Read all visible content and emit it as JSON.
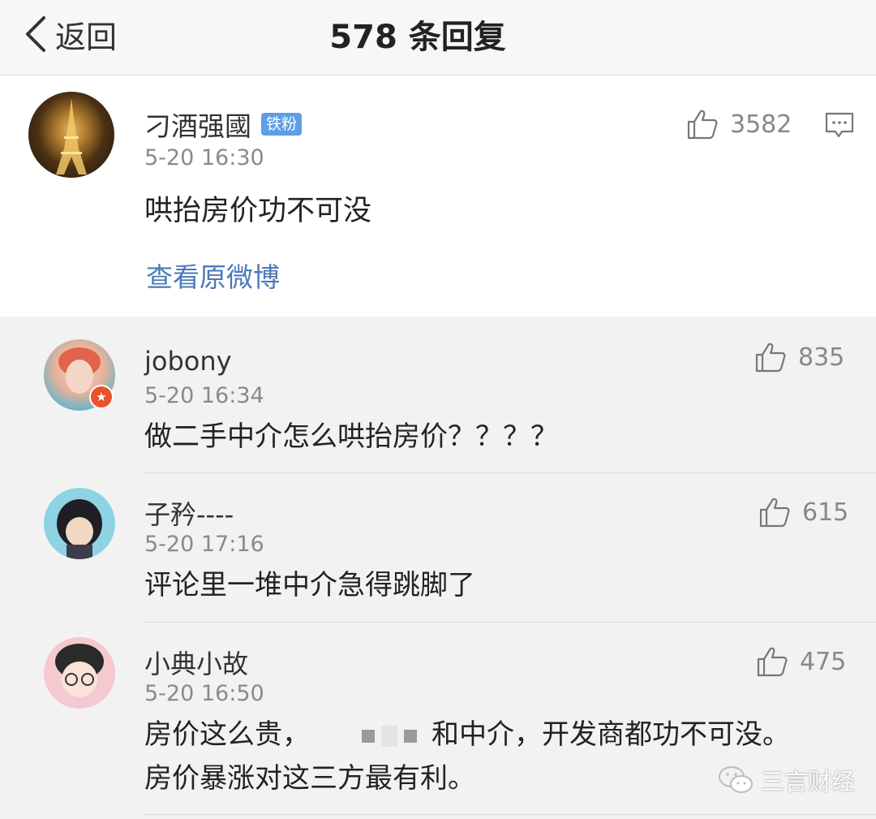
{
  "header": {
    "back_label": "返回",
    "title": "578 条回复"
  },
  "main_comment": {
    "name": "刁酒强國",
    "badge": "铁粉",
    "time": "5-20 16:30",
    "text": "哄抬房价功不可没",
    "likes": "3582",
    "view_original": "查看原微博"
  },
  "replies": [
    {
      "name": "jobony",
      "time": "5-20 16:34",
      "text": "做二手中介怎么哄抬房价？？？？",
      "likes": "835"
    },
    {
      "name": "子矜----",
      "time": "5-20 17:16",
      "text": "评论里一堆中介急得跳脚了",
      "likes": "615"
    },
    {
      "name": "小典小故",
      "time": "5-20 16:50",
      "text_a": "房价这么贵，",
      "text_b": "和中介，开发商都功不可没。",
      "text_line2": "房价暴涨对这三方最有利。",
      "likes": "475"
    }
  ],
  "watermark": {
    "text": "三言财经"
  },
  "colors": {
    "link": "#4c79b8",
    "badge": "#5d9ee6",
    "background": "#f2f2f2"
  }
}
